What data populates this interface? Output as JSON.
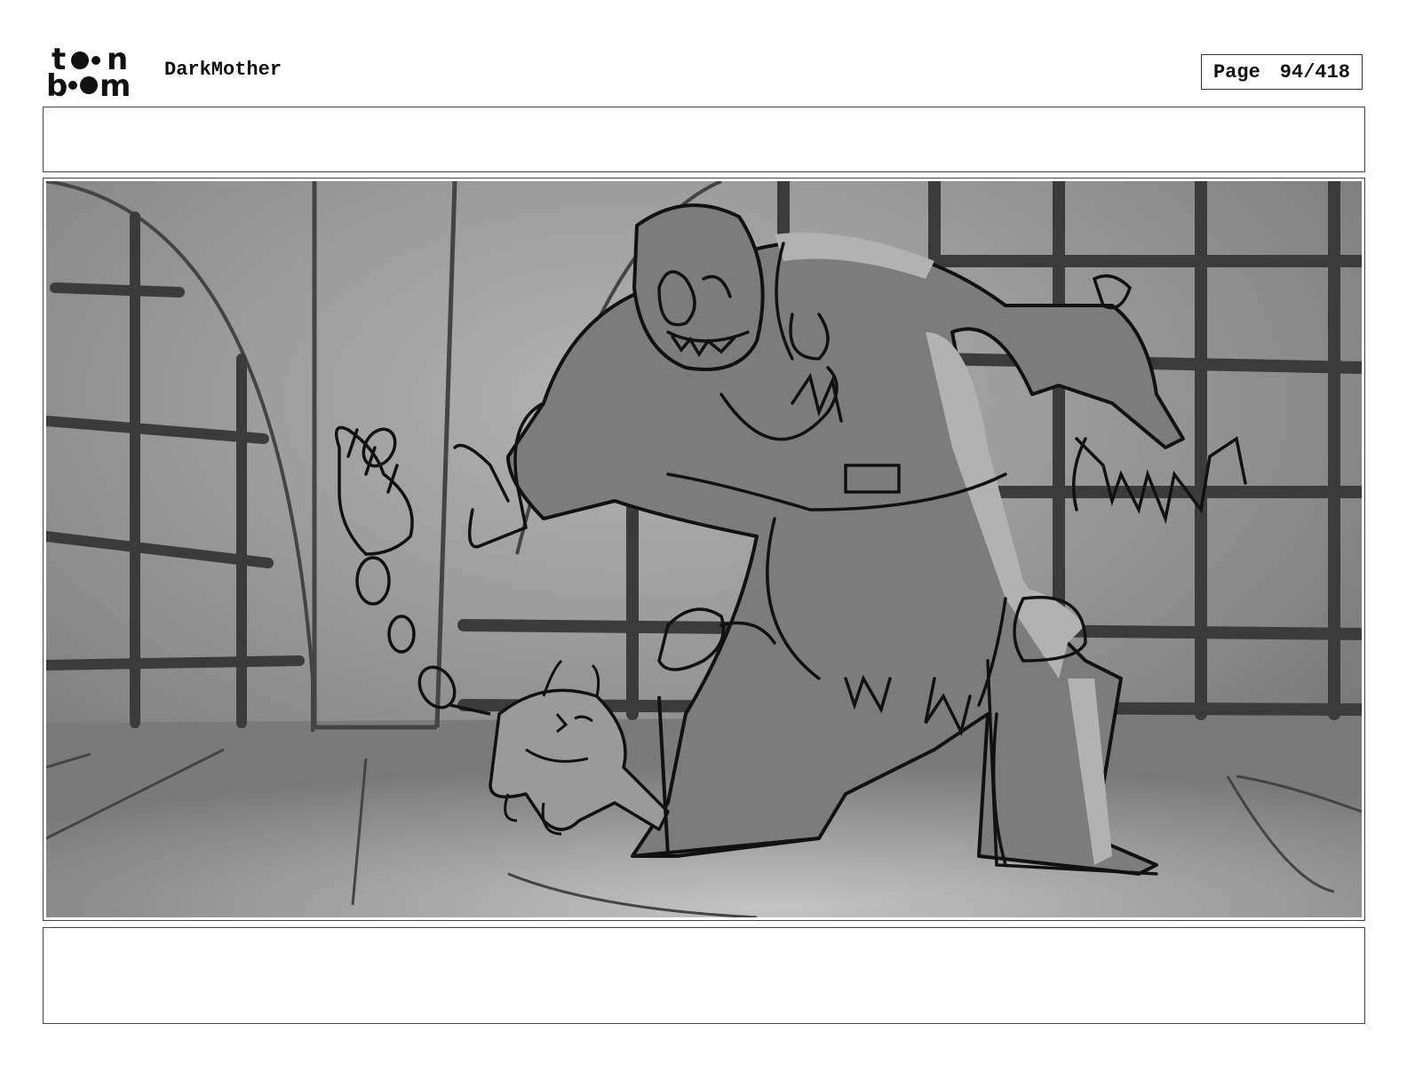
{
  "header": {
    "logo_text": "toonboom",
    "project_title": "DarkMother",
    "page_label": "Page",
    "page_number": "94/418"
  },
  "panel": {
    "image_icon": "storyboard-sketch-image"
  },
  "colors": {
    "background": "#ffffff",
    "border": "#444444",
    "sketch_dark": "#3a3a3a",
    "sketch_mid": "#7a7a7a",
    "sketch_light": "#b0b0b0"
  }
}
